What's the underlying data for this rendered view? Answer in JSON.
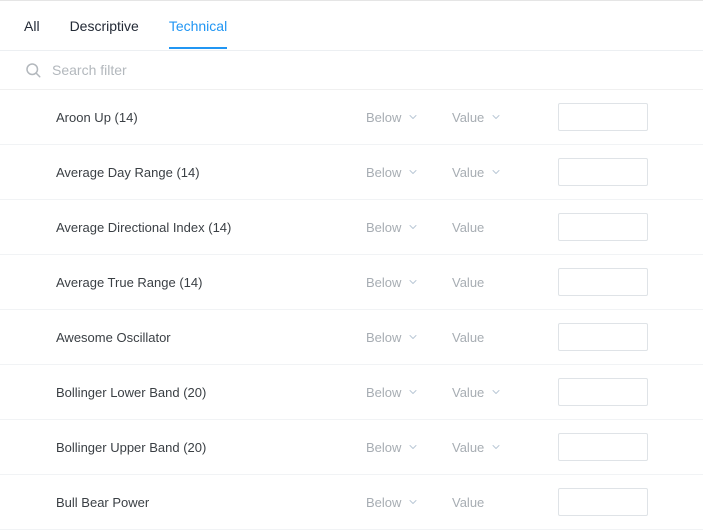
{
  "tabs": {
    "all": "All",
    "descriptive": "Descriptive",
    "technical": "Technical",
    "active": "technical"
  },
  "search": {
    "placeholder": "Search filter"
  },
  "dd_below": "Below",
  "dd_value": "Value",
  "filters": [
    {
      "label": "Aroon Up (14)",
      "has_value_chevron": true
    },
    {
      "label": "Average Day Range (14)",
      "has_value_chevron": true
    },
    {
      "label": "Average Directional Index (14)",
      "has_value_chevron": false
    },
    {
      "label": "Average True Range (14)",
      "has_value_chevron": false
    },
    {
      "label": "Awesome Oscillator",
      "has_value_chevron": false
    },
    {
      "label": "Bollinger Lower Band (20)",
      "has_value_chevron": true
    },
    {
      "label": "Bollinger Upper Band (20)",
      "has_value_chevron": true
    },
    {
      "label": "Bull Bear Power",
      "has_value_chevron": false
    }
  ]
}
